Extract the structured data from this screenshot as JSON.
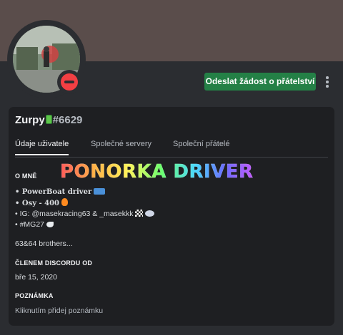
{
  "header": {
    "friend_request_label": "Odeslat žádost o přátelství",
    "status": "do-not-disturb",
    "status_color": "#f23f43",
    "button_color": "#248046"
  },
  "profile": {
    "username": "Zurpy",
    "discriminator": "#6629"
  },
  "tabs": [
    {
      "label": "Údaje uživatele",
      "active": true
    },
    {
      "label": "Společné servery",
      "active": false
    },
    {
      "label": "Společní přátelé",
      "active": false
    }
  ],
  "about": {
    "title": "O MNĚ",
    "banner_text": "PONORKA DRIVER",
    "lines": [
      "• PowerBoat driver",
      "• Osy - 400",
      "• IG: @masekracing63 & _masekkk",
      "• #MG27"
    ],
    "footer": "63&64 brothers..."
  },
  "member_since": {
    "title": "ČLENEM DISCORDU OD",
    "date": "bře 15, 2020"
  },
  "note": {
    "title": "POZNÁMKA",
    "placeholder": "Kliknutím přidej poznámku"
  },
  "icons": {
    "username_badge": "phone-icon",
    "line1_emoji": "speedboat-icon",
    "line2_emoji": "fire-icon",
    "line3_emoji": "checkered-flag-icon",
    "line3_emoji2": "dash-icon",
    "line4_emoji": "dove-icon",
    "more": "more-vertical-icon"
  }
}
